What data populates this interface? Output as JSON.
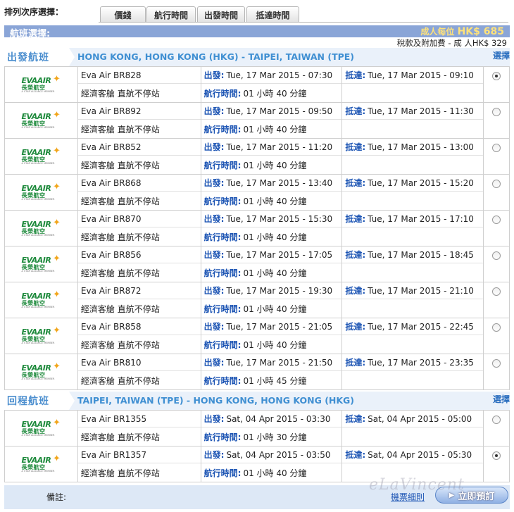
{
  "sort": {
    "label": "排列次序選擇：",
    "tabs": [
      "價錢",
      "航行時間",
      "出發時間",
      "抵達時間"
    ]
  },
  "header": {
    "title": "航班選擇:",
    "price_prefix": "成人每位",
    "price_value": "HK$ 685",
    "tax_line": "稅款及附加費 - 成 人HK$ 329"
  },
  "labels": {
    "depart": "出發:",
    "arrive": "抵達:",
    "duration": "航行時間:",
    "choose": "選擇"
  },
  "logo": {
    "eva": "EVAAIR",
    "cn": "長榮航空",
    "tag": "A STAR ALLIANCE MEMBER"
  },
  "outbound": {
    "label": "出發航班",
    "route": "HONG KONG, HONG KONG (HKG) - TAIPEI, TAIWAN (TPE)",
    "flights": [
      {
        "flight": "Eva Air BR828",
        "cabin": "經濟客艙 直航不停站",
        "depart": "Tue, 17 Mar 2015  - 07:30",
        "arrive": "Tue, 17 Mar 2015  - 09:10",
        "duration": "01 小時 40 分鐘",
        "selected": true
      },
      {
        "flight": "Eva Air BR892",
        "cabin": "經濟客艙 直航不停站",
        "depart": "Tue, 17 Mar 2015  - 09:50",
        "arrive": "Tue, 17 Mar 2015  - 11:30",
        "duration": "01 小時 40 分鐘",
        "selected": false
      },
      {
        "flight": "Eva Air BR852",
        "cabin": "經濟客艙 直航不停站",
        "depart": "Tue, 17 Mar 2015  - 11:20",
        "arrive": "Tue, 17 Mar 2015  - 13:00",
        "duration": "01 小時 40 分鐘",
        "selected": false
      },
      {
        "flight": "Eva Air BR868",
        "cabin": "經濟客艙 直航不停站",
        "depart": "Tue, 17 Mar 2015  - 13:40",
        "arrive": "Tue, 17 Mar 2015  - 15:20",
        "duration": "01 小時 40 分鐘",
        "selected": false
      },
      {
        "flight": "Eva Air BR870",
        "cabin": "經濟客艙 直航不停站",
        "depart": "Tue, 17 Mar 2015  - 15:30",
        "arrive": "Tue, 17 Mar 2015  - 17:10",
        "duration": "01 小時 40 分鐘",
        "selected": false
      },
      {
        "flight": "Eva Air BR856",
        "cabin": "經濟客艙 直航不停站",
        "depart": "Tue, 17 Mar 2015  - 17:05",
        "arrive": "Tue, 17 Mar 2015  - 18:45",
        "duration": "01 小時 40 分鐘",
        "selected": false
      },
      {
        "flight": "Eva Air BR872",
        "cabin": "經濟客艙 直航不停站",
        "depart": "Tue, 17 Mar 2015  - 19:30",
        "arrive": "Tue, 17 Mar 2015  - 21:10",
        "duration": "01 小時 40 分鐘",
        "selected": false
      },
      {
        "flight": "Eva Air BR858",
        "cabin": "經濟客艙 直航不停站",
        "depart": "Tue, 17 Mar 2015  - 21:05",
        "arrive": "Tue, 17 Mar 2015  - 22:45",
        "duration": "01 小時 40 分鐘",
        "selected": false
      },
      {
        "flight": "Eva Air BR810",
        "cabin": "經濟客艙 直航不停站",
        "depart": "Tue, 17 Mar 2015  - 21:50",
        "arrive": "Tue, 17 Mar 2015  - 23:35",
        "duration": "01 小時 45 分鐘",
        "selected": false
      }
    ]
  },
  "inbound": {
    "label": "回程航班",
    "route": "TAIPEI, TAIWAN (TPE) - HONG KONG, HONG KONG (HKG)",
    "flights": [
      {
        "flight": "Eva Air BR1355",
        "cabin": "經濟客艙 直航不停站",
        "depart": "Sat, 04 Apr 2015  - 03:30",
        "arrive": "Sat, 04 Apr 2015  - 05:00",
        "duration": "01 小時 30 分鐘",
        "selected": false
      },
      {
        "flight": "Eva Air BR1357",
        "cabin": "經濟客艙 直航不停站",
        "depart": "Sat, 04 Apr 2015  - 03:50",
        "arrive": "Sat, 04 Apr 2015  - 05:30",
        "duration": "01 小時 40 分鐘",
        "selected": true
      }
    ]
  },
  "footer": {
    "note": "備註:",
    "terms": "機票細則",
    "book": "立即預訂",
    "watermark": "eLaVincent"
  }
}
